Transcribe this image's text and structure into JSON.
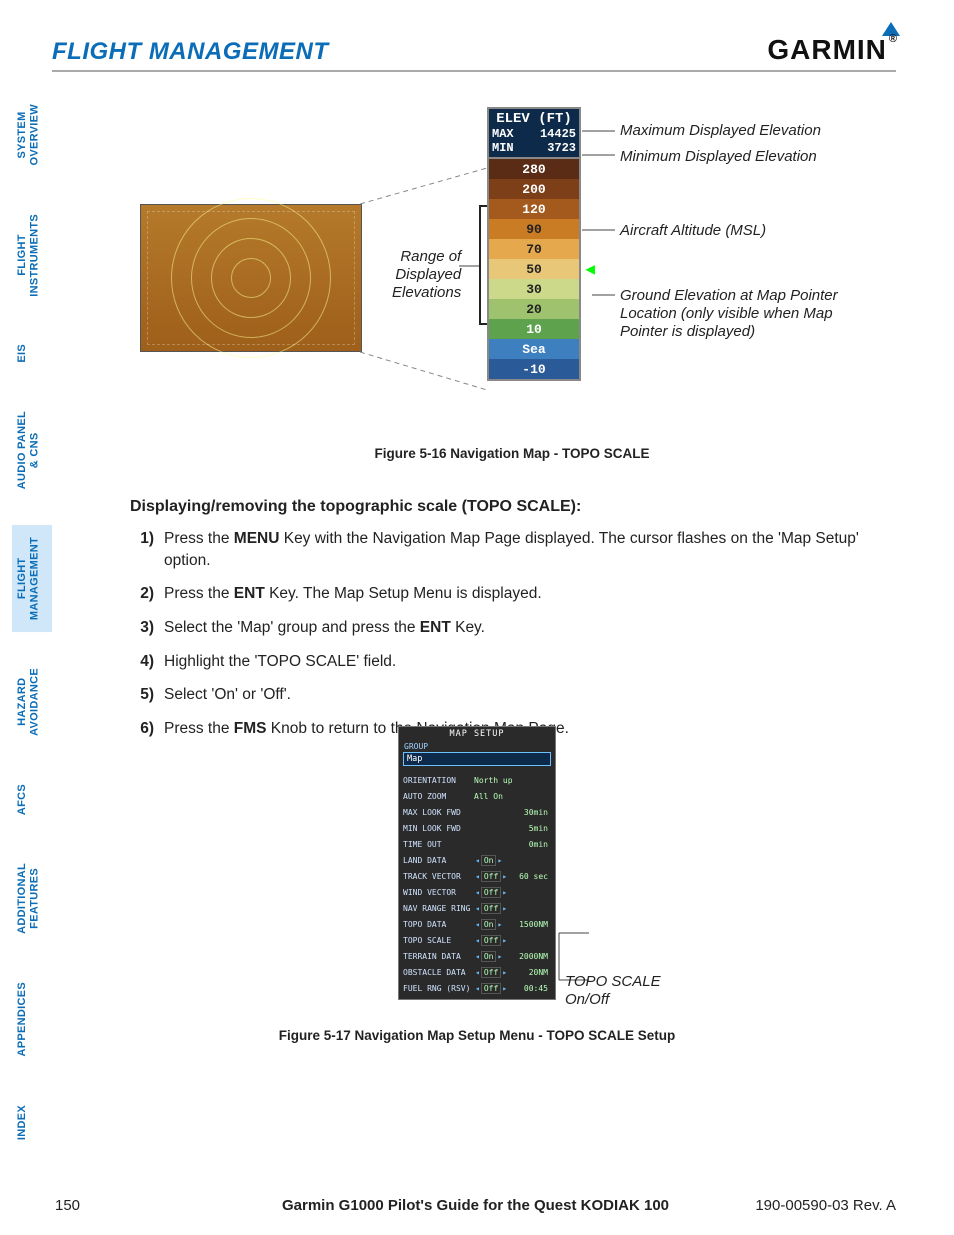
{
  "header": {
    "section_title": "FLIGHT MANAGEMENT",
    "logo_text": "GARMIN"
  },
  "tabs": [
    {
      "label": "SYSTEM\nOVERVIEW",
      "active": false
    },
    {
      "label": "FLIGHT\nINSTRUMENTS",
      "active": false
    },
    {
      "label": "EIS",
      "active": false
    },
    {
      "label": "AUDIO PANEL\n& CNS",
      "active": false
    },
    {
      "label": "FLIGHT\nMANAGEMENT",
      "active": true
    },
    {
      "label": "HAZARD\nAVOIDANCE",
      "active": false
    },
    {
      "label": "AFCS",
      "active": false
    },
    {
      "label": "ADDITIONAL\nFEATURES",
      "active": false
    },
    {
      "label": "APPENDICES",
      "active": false
    },
    {
      "label": "INDEX",
      "active": false
    }
  ],
  "fig1": {
    "elev_header": "ELEV (FT)",
    "max_label": "MAX",
    "max_val": "14425",
    "min_label": "MIN",
    "min_val": "3723",
    "scale": [
      {
        "v": "280",
        "bg": "#5a2c16",
        "fg": "#fff"
      },
      {
        "v": "200",
        "bg": "#7d3f18",
        "fg": "#fff"
      },
      {
        "v": "120",
        "bg": "#a55a1d",
        "fg": "#fff"
      },
      {
        "v": "90",
        "bg": "#c97c24",
        "fg": "#222"
      },
      {
        "v": "70",
        "bg": "#e6a84c",
        "fg": "#222"
      },
      {
        "v": "50",
        "bg": "#e8c878",
        "fg": "#222"
      },
      {
        "v": "30",
        "bg": "#cdd98a",
        "fg": "#222"
      },
      {
        "v": "20",
        "bg": "#9ec26e",
        "fg": "#222"
      },
      {
        "v": "10",
        "bg": "#5fa24e",
        "fg": "#fff"
      },
      {
        "v": "Sea",
        "bg": "#3d7fbf",
        "fg": "#fff"
      },
      {
        "v": "-10",
        "bg": "#2a5a97",
        "fg": "#fff"
      }
    ],
    "pointer_scale_index": 5,
    "bracket_start_index": 2,
    "bracket_end_index": 7,
    "callouts": {
      "max_elev": "Maximum Displayed Elevation",
      "min_elev": "Minimum Displayed Elevation",
      "aircraft_alt": "Aircraft Altitude (MSL)",
      "pointer": "Ground Elevation at Map Pointer Location (only visible when Map Pointer is displayed)",
      "range": "Range of\nDisplayed\nElevations"
    },
    "caption": "Figure 5-16  Navigation Map - TOPO SCALE"
  },
  "body": {
    "subhead": "Displaying/removing the topographic scale (TOPO SCALE):",
    "steps": [
      {
        "n": "1)",
        "pre": "Press the ",
        "bold": "MENU",
        "post": " Key with the Navigation Map Page displayed.  The cursor flashes on the 'Map Setup' option."
      },
      {
        "n": "2)",
        "pre": "Press the ",
        "bold": "ENT",
        "post": " Key.  The Map Setup Menu is displayed."
      },
      {
        "n": "3)",
        "pre": "Select the 'Map' group and press the ",
        "bold": "ENT",
        "post": " Key."
      },
      {
        "n": "4)",
        "pre": "Highlight the 'TOPO SCALE' field.",
        "bold": "",
        "post": ""
      },
      {
        "n": "5)",
        "pre": "Select 'On' or 'Off'.",
        "bold": "",
        "post": ""
      },
      {
        "n": "6)",
        "pre": "Press the ",
        "bold": "FMS",
        "post": " Knob to return to the Navigation Map Page."
      }
    ]
  },
  "fig2": {
    "title": "MAP SETUP",
    "group_label": "GROUP",
    "group_value": "Map",
    "rows": [
      {
        "lab": "ORIENTATION",
        "val": "North up",
        "extra": ""
      },
      {
        "lab": "AUTO ZOOM",
        "val": "All On",
        "extra": ""
      },
      {
        "lab": "  MAX LOOK FWD",
        "val": "",
        "extra": "30min"
      },
      {
        "lab": "  MIN LOOK FWD",
        "val": "",
        "extra": "5min"
      },
      {
        "lab": "  TIME OUT",
        "val": "",
        "extra": "0min"
      },
      {
        "lab": "LAND DATA",
        "val": "◂On▸",
        "extra": ""
      },
      {
        "lab": "TRACK VECTOR",
        "val": "◂Off▸",
        "extra": "60 sec"
      },
      {
        "lab": "WIND VECTOR",
        "val": "◂Off▸",
        "extra": ""
      },
      {
        "lab": "NAV RANGE RING",
        "val": "◂Off▸",
        "extra": ""
      },
      {
        "lab": "TOPO DATA",
        "val": "◂On▸",
        "extra": "1500NM"
      },
      {
        "lab": "TOPO SCALE",
        "val": "◂Off▸",
        "extra": ""
      },
      {
        "lab": "TERRAIN DATA",
        "val": "◂On▸",
        "extra": "2000NM"
      },
      {
        "lab": "OBSTACLE DATA",
        "val": "◂Off▸",
        "extra": "20NM"
      },
      {
        "lab": "FUEL RNG (RSV)",
        "val": "◂Off▸",
        "extra": "00:45"
      }
    ],
    "callout": "TOPO SCALE\nOn/Off",
    "caption": "Figure 5-17  Navigation Map Setup Menu - TOPO SCALE Setup"
  },
  "footer": {
    "page": "150",
    "center": "Garmin G1000 Pilot's Guide for the Quest KODIAK 100",
    "right": "190-00590-03  Rev. A"
  }
}
